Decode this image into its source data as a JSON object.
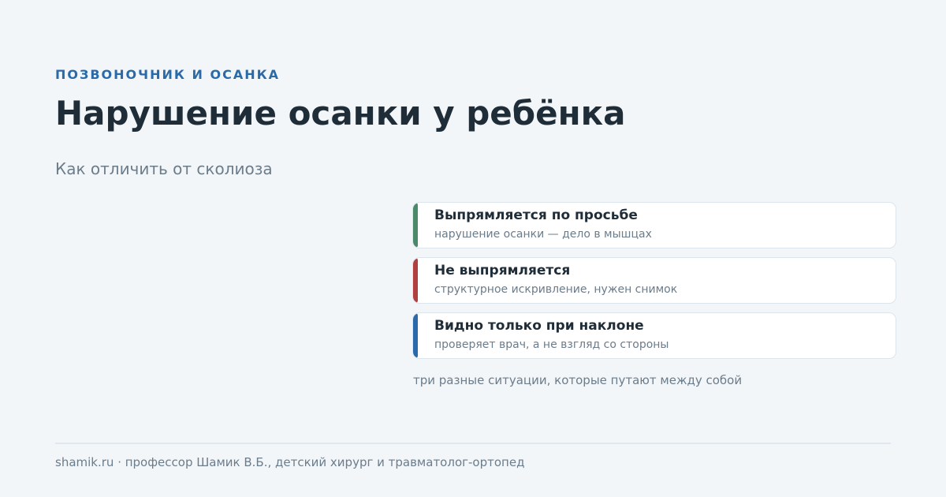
{
  "header": {
    "kicker": "ПОЗВОНОЧНИК И ОСАНКА",
    "title": "Нарушение осанки у ребёнка",
    "subtitle": "Как отличить от сколиоза"
  },
  "cards": [
    {
      "title": "Выпрямляется по просьбе",
      "description": "нарушение осанки — дело в мышцах",
      "accent_color": "#4a8a6a"
    },
    {
      "title": "Не выпрямляется",
      "description": "структурное искривление, нужен снимок",
      "accent_color": "#b04040"
    },
    {
      "title": "Видно только при наклоне",
      "description": "проверяет врач, а не взгляд со стороны",
      "accent_color": "#2b6aa8"
    }
  ],
  "caption": "три разные ситуации, которые путают между собой",
  "footer": {
    "text": "shamik.ru · профессор Шамик В.Б., детский хирург и травматолог-ортопед"
  },
  "colors": {
    "background": "#f3f6f9",
    "accent": "#2b6aa8",
    "heading": "#1f2d38",
    "muted": "#6b7c8b"
  }
}
